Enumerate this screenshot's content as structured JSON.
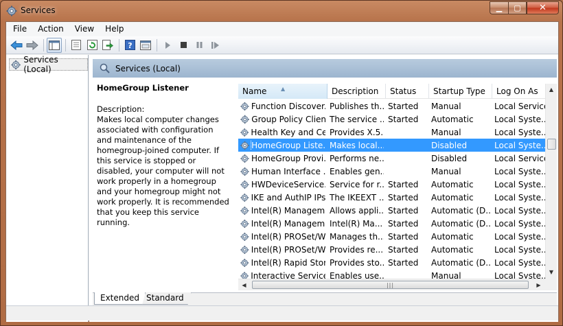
{
  "window": {
    "title": "Services",
    "title_icon": "gear-icon"
  },
  "menu": [
    "File",
    "Action",
    "View",
    "Help"
  ],
  "toolbar": {
    "buttons": [
      "back-icon",
      "forward-icon",
      "show-tree-icon",
      "properties-icon",
      "refresh-icon",
      "export-icon",
      "help-icon",
      "console-icon",
      "start-icon",
      "stop-icon",
      "pause-icon",
      "restart-icon"
    ]
  },
  "tree": {
    "item": "Services (Local)"
  },
  "content": {
    "header": "Services (Local)",
    "selected_name": "HomeGroup Listener",
    "description_label": "Description:",
    "description_text": "Makes local computer changes associated with configuration and maintenance of the homegroup-joined computer. If this service is stopped or disabled, your computer will not work properly in a homegroup and your homegroup might not work properly. It is recommended that you keep this service running."
  },
  "columns": [
    "Name",
    "Description",
    "Status",
    "Startup Type",
    "Log On As"
  ],
  "rows": [
    {
      "name": "Function Discover...",
      "desc": "Publishes th...",
      "status": "Started",
      "startup": "Manual",
      "logon": "Local Service"
    },
    {
      "name": "Group Policy Client",
      "desc": "The service ...",
      "status": "Started",
      "startup": "Automatic",
      "logon": "Local Syste..."
    },
    {
      "name": "Health Key and Ce...",
      "desc": "Provides X.5...",
      "status": "",
      "startup": "Manual",
      "logon": "Local Syste..."
    },
    {
      "name": "HomeGroup Liste...",
      "desc": "Makes local...",
      "status": "",
      "startup": "Disabled",
      "logon": "Local Syste...",
      "selected": true
    },
    {
      "name": "HomeGroup Provi...",
      "desc": "Performs ne...",
      "status": "",
      "startup": "Disabled",
      "logon": "Local Service"
    },
    {
      "name": "Human Interface ...",
      "desc": "Enables gen...",
      "status": "",
      "startup": "Manual",
      "logon": "Local Syste..."
    },
    {
      "name": "HWDeviceService...",
      "desc": "Service for r...",
      "status": "Started",
      "startup": "Automatic",
      "logon": "Local Syste..."
    },
    {
      "name": "IKE and AuthIP IPs...",
      "desc": "The IKEEXT ...",
      "status": "Started",
      "startup": "Automatic",
      "logon": "Local Syste..."
    },
    {
      "name": "Intel(R) Managem...",
      "desc": "Allows appli...",
      "status": "Started",
      "startup": "Automatic (D...",
      "logon": "Local Syste..."
    },
    {
      "name": "Intel(R) Managem...",
      "desc": "Intel(R) Ma...",
      "status": "Started",
      "startup": "Automatic (D...",
      "logon": "Local Syste..."
    },
    {
      "name": "Intel(R) PROSet/W...",
      "desc": "Manages th...",
      "status": "Started",
      "startup": "Automatic",
      "logon": "Local Syste..."
    },
    {
      "name": "Intel(R) PROSet/W...",
      "desc": "Provides re...",
      "status": "Started",
      "startup": "Automatic",
      "logon": "Local Syste..."
    },
    {
      "name": "Intel(R) Rapid Stor...",
      "desc": "Provides sto...",
      "status": "Started",
      "startup": "Automatic (D...",
      "logon": "Local Syste..."
    },
    {
      "name": "Interactive Service...",
      "desc": "Enables use...",
      "status": "",
      "startup": "Manual",
      "logon": "Local Syste..."
    }
  ],
  "tabs": [
    "Extended",
    "Standard"
  ],
  "colors": {
    "selection": "#3399ff",
    "header_band": "#a9bfd7",
    "frame": "#b7734b"
  }
}
